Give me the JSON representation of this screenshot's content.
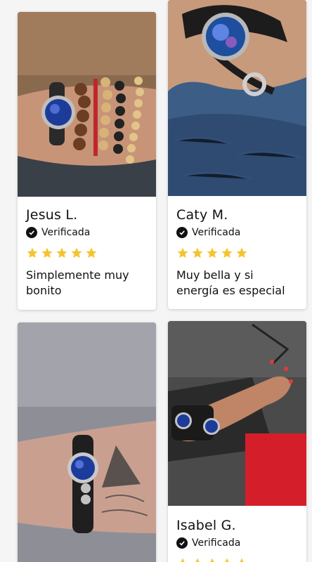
{
  "reviews": [
    {
      "name": "Jesus L.",
      "verified_label": "Verificada",
      "rating": 5,
      "text": "Simplemente muy bonito",
      "photo_icon": "bracelet-stack-photo"
    },
    {
      "name": "Caty M.",
      "verified_label": "Verificada",
      "rating": 5,
      "text": "Muy bella y si energía es especial",
      "photo_icon": "bracelet-wrist-photo"
    },
    {
      "name": "",
      "verified_label": "",
      "rating": null,
      "text": "",
      "photo_icon": "bracelet-tattoo-arm-photo"
    },
    {
      "name": "Isabel G.",
      "verified_label": "Verificada",
      "rating": 5,
      "text": "",
      "photo_icon": "bracelet-hand-photo"
    }
  ],
  "colors": {
    "star": "#F4C430",
    "card_bg": "#FFFFFF",
    "page_bg": "#F5F5F5"
  }
}
